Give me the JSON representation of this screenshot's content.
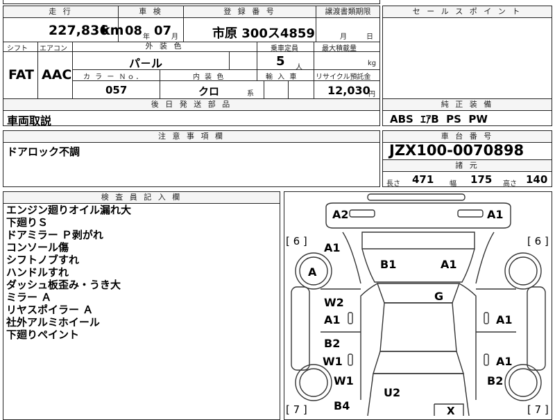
{
  "header": {
    "mileage_label": "走 行",
    "inspection_label": "車 検",
    "registration_label": "登 録 番 号",
    "transfer_label": "譲渡書類期限",
    "sales_point_label": "セ ー ル ス ポ イ ン ト"
  },
  "mileage": {
    "value": "227,836",
    "unit": "km"
  },
  "inspection": {
    "year": "08",
    "year_unit": "年",
    "month": "07",
    "month_unit": "月"
  },
  "registration": {
    "value": "市原 300ス4859"
  },
  "transfer": {
    "month_unit": "月",
    "day_unit": "日"
  },
  "spec": {
    "shift_label": "シフト",
    "ac_label": "エアコン",
    "exterior_color_label": "外 装 色",
    "capacity_label": "乗車定員",
    "max_load_label": "最大積載量",
    "shift": "FAT",
    "ac": "AAC",
    "exterior_color": "パ－ル",
    "capacity": "5",
    "capacity_unit": "人",
    "load_unit": "kg",
    "color_no_label": "カ ラ ー Ｎｏ．",
    "interior_color_label": "内 装 色",
    "import_label": "輸 入 車",
    "recycle_label": "リサイクル預託金",
    "color_no": "057",
    "interior_color": "クロ",
    "interior_suffix": "系",
    "recycle_fee": "12,030",
    "recycle_unit": "円"
  },
  "post_parts": {
    "label": "後 日 発 送 部 品",
    "value": "車両取説"
  },
  "standard_equipment": {
    "label": "純 正 装 備",
    "value": "ABS  ｴｱB  PS  PW"
  },
  "caution": {
    "label": "注 意 事 項 欄",
    "value": "ドアロック不調"
  },
  "chassis": {
    "label": "車 台 番 号",
    "value": "JZX100-0070898",
    "dims_label": "諸 元",
    "length_label": "長さ",
    "length": "471",
    "width_label": "幅",
    "width": "175",
    "height_label": "高さ",
    "height": "140"
  },
  "inspector": {
    "label": "検 査 員 記 入 欄",
    "notes": [
      "エンジン廻りオイル漏れ大",
      "下廻りＳ",
      "ドアミラー Ｐ剥がれ",
      "コンソール傷",
      "シフトノブすれ",
      "ハンドルすれ",
      "ダッシュ板歪み・うき大",
      "ミラー Ａ",
      "リヤスポイラー Ａ",
      "社外アルミホイール",
      "下廻りペイント"
    ]
  },
  "diagram": {
    "tire_front_left": "[ 6 ]",
    "tire_front_right": "[ 6 ]",
    "tire_rear_left": "[ 7 ]",
    "tire_rear_right": "[ 7 ]",
    "marks": {
      "front_bumper_left": "A2",
      "front_bumper_right": "A1",
      "fender_left": "A1",
      "wheel_front_left": "A",
      "hood_b1": "B1",
      "hood_a1": "A1",
      "roof": "G",
      "door_fl_w2": "W2",
      "door_fl_a1": "A1",
      "door_fr_a1": "A1",
      "door_rl_b2": "B2",
      "door_rl_w1": "W1",
      "door_rr_a1": "A1",
      "quarter_left": "W1",
      "quarter_right": "B2",
      "trunk": "U2",
      "rear_left": "B4",
      "rear_center": "X"
    }
  }
}
